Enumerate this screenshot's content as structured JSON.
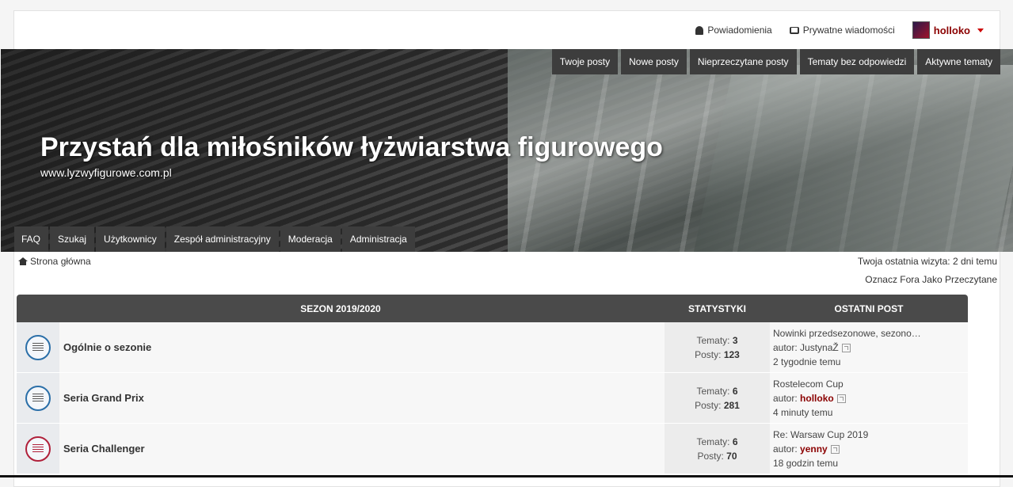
{
  "topbar": {
    "notifications": "Powiadomienia",
    "private_messages": "Prywatne wiadomości",
    "username": "holloko"
  },
  "banner": {
    "site_title": "Przystań dla miłośników łyżwiarstwa figurowego",
    "site_url": "www.lyzwyfigurowe.com.pl",
    "nav_right": [
      "Twoje posty",
      "Nowe posty",
      "Nieprzeczytane posty",
      "Tematy bez odpowiedzi",
      "Aktywne tematy"
    ],
    "nav_left": [
      "FAQ",
      "Szukaj",
      "Użytkownicy",
      "Zespół administracyjny",
      "Moderacja",
      "Administracja"
    ]
  },
  "breadcrumb": {
    "home": "Strona główna"
  },
  "last_visit": "Twoja ostatnia wizyta: 2 dni temu",
  "mark_read": "Oznacz Fora Jako Przeczytane",
  "forum": {
    "header": {
      "title": "SEZON 2019/2020",
      "stats": "STATYSTYKI",
      "last_post": "OSTATNI POST"
    },
    "rows": [
      {
        "title": "Ogólnie o sezonie",
        "topics_label": "Tematy:",
        "topics": "3",
        "posts_label": "Posty:",
        "posts": "123",
        "last_title": "Nowinki przedsezonowe, sezono…",
        "author_label": "autor:",
        "author": "JustynaŽ",
        "author_strong": false,
        "time": "2 tygodnie temu",
        "icon_color": "blue"
      },
      {
        "title": "Seria Grand Prix",
        "topics_label": "Tematy:",
        "topics": "6",
        "posts_label": "Posty:",
        "posts": "281",
        "last_title": "Rostelecom Cup",
        "author_label": "autor:",
        "author": "holloko",
        "author_strong": true,
        "time": "4 minuty temu",
        "icon_color": "blue"
      },
      {
        "title": "Seria Challenger",
        "topics_label": "Tematy:",
        "topics": "6",
        "posts_label": "Posty:",
        "posts": "70",
        "last_title": "Re: Warsaw Cup 2019",
        "author_label": "autor:",
        "author": "yenny",
        "author_strong": true,
        "time": "18 godzin temu",
        "icon_color": "red"
      }
    ]
  }
}
